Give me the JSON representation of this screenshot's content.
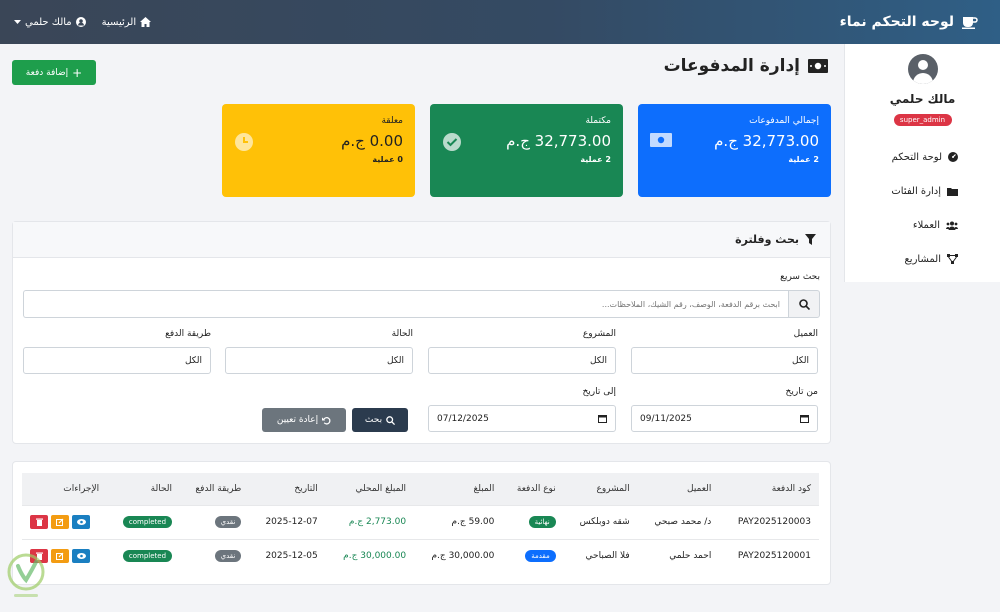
{
  "navbar": {
    "brand": "لوحه التحكم نماء",
    "home_label": "الرئيسية",
    "user_label": "مالك حلمي"
  },
  "sidebar": {
    "user_name": "مالك حلمي",
    "role": "super_admin",
    "items": [
      {
        "label": "لوحة التحكم",
        "icon": "dashboard-icon"
      },
      {
        "label": "إدارة الفئات",
        "icon": "folder-icon"
      },
      {
        "label": "العملاء",
        "icon": "users-icon"
      },
      {
        "label": "المشاريع",
        "icon": "project-diagram-icon"
      }
    ]
  },
  "page": {
    "title": "إدارة المدفوعات",
    "add_button": "إضافة دفعة"
  },
  "stats": {
    "total": {
      "label": "إجمالي المدفوعات",
      "value": "32,773.00 ج.م",
      "sub": "2 عملية"
    },
    "completed": {
      "label": "مكتملة",
      "value": "32,773.00 ج.م",
      "sub": "2 عملية"
    },
    "pending": {
      "label": "معلقة",
      "value": "0.00 ج.م",
      "sub": "0 عملية"
    }
  },
  "filter": {
    "title": "بحث وفلترة",
    "quick_label": "بحث سريع",
    "quick_placeholder": "ابحث برقم الدفعة، الوصف، رقم الشيك، الملاحظات...",
    "client_label": "العميل",
    "client_value": "الكل",
    "project_label": "المشروع",
    "project_value": "الكل",
    "status_label": "الحالة",
    "status_value": "الكل",
    "method_label": "طريقة الدفع",
    "method_value": "الكل",
    "from_label": "من تاريخ",
    "from_value": "09/11/2025",
    "to_label": "إلى تاريخ",
    "to_value": "07/12/2025",
    "search_button": "بحث",
    "reset_button": "إعادة تعيين"
  },
  "table": {
    "headers": [
      "كود الدفعة",
      "العميل",
      "المشروع",
      "نوع الدفعة",
      "المبلغ",
      "المبلغ المحلي",
      "التاريخ",
      "طريقة الدفع",
      "الحالة",
      "الإجراءات"
    ],
    "rows": [
      {
        "code": "PAY2025120003",
        "client": "د/ محمد صبحي",
        "project": "شقه دوبلكس",
        "type": "نهائية",
        "amount": "59.00 ج.م",
        "local_amount": "2,773.00 ج.م",
        "date": "2025-12-07",
        "method": "نقدي",
        "status": "completed"
      },
      {
        "code": "PAY2025120001",
        "client": "احمد حلمي",
        "project": "فلا الصباحي",
        "type": "مقدمة",
        "amount": "30,000.00 ج.م",
        "local_amount": "30,000.00 ج.م",
        "date": "2025-12-05",
        "method": "نقدي",
        "status": "completed"
      }
    ]
  },
  "colors": {
    "primary": "#0d6efd",
    "success": "#198754",
    "warning": "#ffc107",
    "danger": "#dc3545"
  }
}
